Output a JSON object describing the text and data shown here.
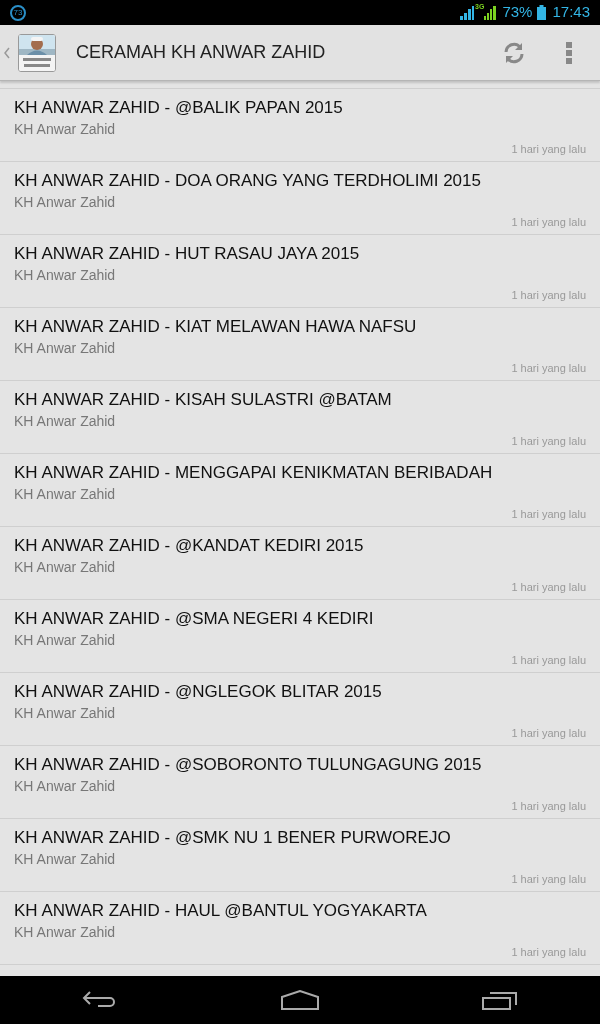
{
  "status_bar": {
    "notification": "73",
    "battery": "73%",
    "time": "17:43",
    "network": "3G"
  },
  "action_bar": {
    "title": "CERAMAH KH ANWAR ZAHID"
  },
  "items": [
    {
      "title": "KH ANWAR ZAHID - @BALIK PAPAN 2015",
      "author": "KH Anwar Zahid",
      "time": "1 hari yang lalu"
    },
    {
      "title": "KH ANWAR ZAHID - DOA ORANG YANG TERDHOLIMI 2015",
      "author": "KH Anwar Zahid",
      "time": "1 hari yang lalu"
    },
    {
      "title": "KH ANWAR ZAHID - HUT RASAU JAYA 2015",
      "author": "KH Anwar Zahid",
      "time": "1 hari yang lalu"
    },
    {
      "title": "KH ANWAR ZAHID - KIAT MELAWAN HAWA NAFSU",
      "author": "KH Anwar Zahid",
      "time": "1 hari yang lalu"
    },
    {
      "title": "KH ANWAR ZAHID - KISAH SULASTRI @BATAM",
      "author": "KH Anwar Zahid",
      "time": "1 hari yang lalu"
    },
    {
      "title": "KH ANWAR ZAHID - MENGGAPAI KENIKMATAN BERIBADAH",
      "author": "KH Anwar Zahid",
      "time": "1 hari yang lalu"
    },
    {
      "title": "KH ANWAR ZAHID - @KANDAT KEDIRI 2015",
      "author": "KH Anwar Zahid",
      "time": "1 hari yang lalu"
    },
    {
      "title": "KH ANWAR ZAHID - @SMA NEGERI 4 KEDIRI",
      "author": "KH Anwar Zahid",
      "time": "1 hari yang lalu"
    },
    {
      "title": "KH ANWAR ZAHID - @NGLEGOK BLITAR 2015",
      "author": "KH Anwar Zahid",
      "time": "1 hari yang lalu"
    },
    {
      "title": "KH ANWAR ZAHID - @SOBORONTO TULUNGAGUNG 2015",
      "author": "KH Anwar Zahid",
      "time": "1 hari yang lalu"
    },
    {
      "title": "KH ANWAR ZAHID - @SMK NU 1 BENER PURWOREJO",
      "author": "KH Anwar Zahid",
      "time": "1 hari yang lalu"
    },
    {
      "title": "KH ANWAR ZAHID - HAUL @BANTUL YOGYAKARTA",
      "author": "KH Anwar Zahid",
      "time": "1 hari yang lalu"
    }
  ]
}
